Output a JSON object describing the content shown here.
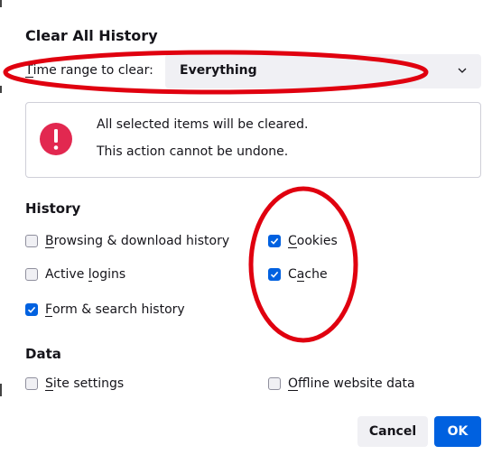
{
  "dialog": {
    "title": "Clear All History"
  },
  "time_range": {
    "label_prefix": "T",
    "label_rest": "ime range to clear:",
    "selected": "Everything"
  },
  "warning": {
    "line1": "All selected items will be cleared.",
    "line2": "This action cannot be undone.",
    "icon": "error-icon",
    "color": "#e22850"
  },
  "history": {
    "heading": "History",
    "items": [
      {
        "pre": "",
        "key": "B",
        "post": "rowsing & download history",
        "checked": false
      },
      {
        "pre": "",
        "key": "C",
        "post": "ookies",
        "checked": true
      },
      {
        "pre": "Active ",
        "key": "l",
        "post": "ogins",
        "checked": false
      },
      {
        "pre": "C",
        "key": "a",
        "post": "che",
        "checked": true
      },
      {
        "pre": "",
        "key": "F",
        "post": "orm & search history",
        "checked": true
      }
    ]
  },
  "data_section": {
    "heading": "Data",
    "items": [
      {
        "pre": "",
        "key": "S",
        "post": "ite settings",
        "checked": false
      },
      {
        "pre": "",
        "key": "O",
        "post": "ffline website data",
        "checked": false
      }
    ]
  },
  "buttons": {
    "cancel": "Cancel",
    "ok": "OK"
  },
  "colors": {
    "accent": "#0061e0",
    "annotation": "#e0000f"
  }
}
